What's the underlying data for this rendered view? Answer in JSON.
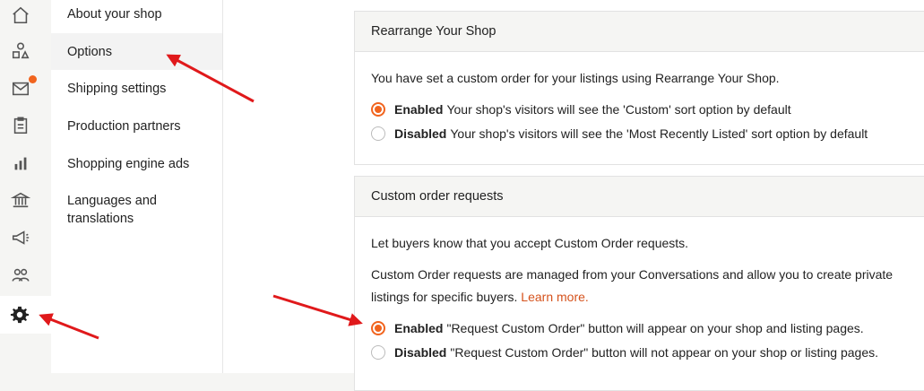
{
  "rail": {
    "icons": [
      "home-icon",
      "shapes-icon",
      "mail-icon",
      "clipboard-icon",
      "stats-icon",
      "bank-icon",
      "megaphone-icon",
      "people-icon",
      "gear-icon"
    ]
  },
  "submenu": {
    "items": [
      {
        "label": "About your shop"
      },
      {
        "label": "Options"
      },
      {
        "label": "Shipping settings"
      },
      {
        "label": "Production partners"
      },
      {
        "label": "Shopping engine ads"
      },
      {
        "label": "Languages and translations"
      }
    ]
  },
  "rearrange": {
    "title": "Rearrange Your Shop",
    "description": "You have set a custom order for your listings using Rearrange Your Shop.",
    "enabled_label": "Enabled",
    "enabled_text": "Your shop's visitors will see the 'Custom' sort option by default",
    "disabled_label": "Disabled",
    "disabled_text": "Your shop's visitors will see the 'Most Recently Listed' sort option by default",
    "selected": "Enabled"
  },
  "custom_order": {
    "title": "Custom order requests",
    "intro": "Let buyers know that you accept Custom Order requests.",
    "desc_line1": "Custom Order requests are managed from your Conversations and allow you to create private",
    "desc_line2": "listings for specific buyers.",
    "learn_more": "Learn more.",
    "enabled_label": "Enabled",
    "enabled_text": "\"Request Custom Order\" button will appear on your shop and listing pages.",
    "disabled_label": "Disabled",
    "disabled_text": "\"Request Custom Order\" button will not appear on your shop or listing pages.",
    "selected": "Enabled"
  },
  "colors": {
    "accent": "#f1641e",
    "annotation_arrow": "#e0191b"
  }
}
